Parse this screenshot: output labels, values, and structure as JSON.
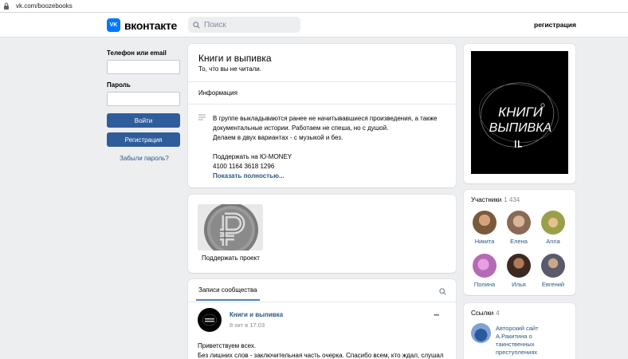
{
  "browser": {
    "url": "vk.com/boozebooks"
  },
  "header": {
    "logo_text": "вконтакте",
    "search_placeholder": "Поиск",
    "register_link": "регистрация"
  },
  "login": {
    "phone_label": "Телефон или email",
    "password_label": "Пароль",
    "login_button": "Войти",
    "register_button": "Регистрация",
    "forgot_link": "Забыли пароль?"
  },
  "group": {
    "name": "Книги и выпивка",
    "status": "То, что вы не читали.",
    "info_heading": "Информация",
    "description_lines": [
      "В группе выкладываются ранее не начитывавшиеся произведения, а также",
      "документальные истории. Работаем не спеша, но с душой.",
      "Делаем в двух вариантах - с музыкой и без.",
      "",
      "Поддержать на Ю-MONEY",
      "4100 1164 3618 1296"
    ],
    "show_more": "Показать полностью..."
  },
  "cover": {
    "title_line1": "КНИГИ",
    "title_line2": "ВЫПИВКА"
  },
  "support": {
    "label": "Поддержать проект"
  },
  "members": {
    "title": "Участники",
    "count": "1 434",
    "people": [
      {
        "name": "Никита",
        "color": "#7a5a3c"
      },
      {
        "name": "Елена",
        "color": "#8a6a54"
      },
      {
        "name": "Anna",
        "color": "#9aa04a"
      },
      {
        "name": "Полина",
        "color": "#b46ab4"
      },
      {
        "name": "Илья",
        "color": "#3c2a22"
      },
      {
        "name": "Евгений",
        "color": "#5a5a6a"
      }
    ]
  },
  "links": {
    "title": "Ссылки",
    "count": "4",
    "items": [
      {
        "text_lines": [
          "Авторский сайт",
          "А.Ракитина о",
          "таинственных",
          "преступлениях"
        ]
      }
    ]
  },
  "wall": {
    "tab_label": "Записи сообщества",
    "post": {
      "author": "Книги и выпивка",
      "date": "8 окт в 17:03",
      "dots": "•••",
      "lines": [
        "Приветствуем всех.",
        "Без лишних слов - заключительная часть очерка. Спасибо всем, кто ждал, слушал"
      ]
    }
  },
  "colors": {
    "accent": "#2f5d9b",
    "link": "#2a5885",
    "vk_blue": "#0077ff",
    "background": "#edeef0"
  }
}
